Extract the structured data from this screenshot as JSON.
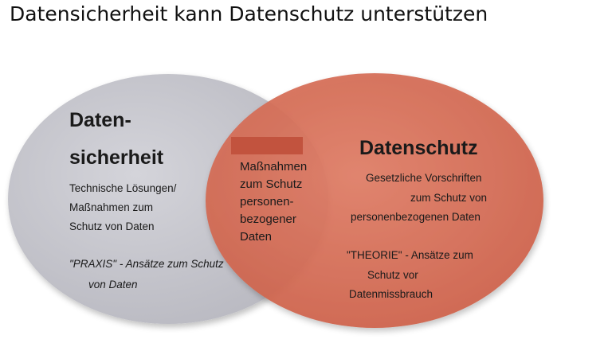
{
  "page_title": "Datensicherheit kann Datenschutz unterstützen",
  "colors": {
    "left_circle": "#c9c9cf",
    "right_circle": "#d9705a",
    "overlap": "#c4654f",
    "redaction_bar": "#c2533e"
  },
  "left_circle": {
    "title_line1": "Daten-",
    "title_line2": "sicherheit",
    "desc_line1": "Technische Lösungen/",
    "desc_line2": "Maßnahmen zum",
    "desc_line3": "Schutz von Daten",
    "note_line1": "\"PRAXIS\" - Ansätze zum Schutz",
    "note_line2": "von Daten"
  },
  "overlap": {
    "line1": "Maßnahmen",
    "line2": "zum Schutz",
    "line3": "personen-",
    "line4": "bezogener",
    "line5": "Daten"
  },
  "right_circle": {
    "title": "Datenschutz",
    "desc_line1": "Gesetzliche Vorschriften",
    "desc_line2": "zum Schutz von",
    "desc_line3": "personenbezogenen Daten",
    "note_line1": "\"THEORIE\" - Ansätze zum",
    "note_line2": "Schutz vor",
    "note_line3": "Datenmissbrauch"
  }
}
